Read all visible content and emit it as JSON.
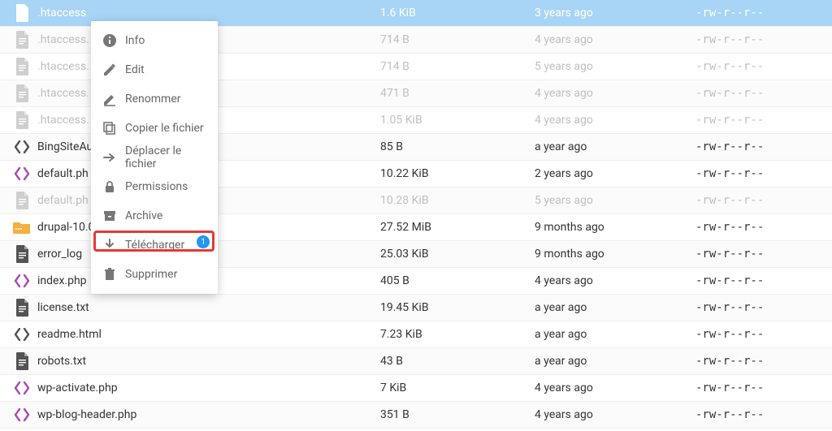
{
  "files": [
    {
      "name": ".htaccess",
      "size": "1.6 KiB",
      "date": "3 years ago",
      "perm": "-rw-r--r--",
      "icon": "doc",
      "selected": true,
      "muted": false
    },
    {
      "name": ".htaccess.",
      "size": "714 B",
      "date": "4 years ago",
      "perm": "-rw-r--r--",
      "icon": "doc",
      "selected": false,
      "muted": true
    },
    {
      "name": ".htaccess.",
      "size": "714 B",
      "date": "5 years ago",
      "perm": "-rw-r--r--",
      "icon": "doc",
      "selected": false,
      "muted": true
    },
    {
      "name": ".htaccess.",
      "size": "471 B",
      "date": "4 years ago",
      "perm": "-rw-r--r--",
      "icon": "doc",
      "selected": false,
      "muted": true
    },
    {
      "name": ".htaccess.",
      "size": "1.05 KiB",
      "date": "4 years ago",
      "perm": "-rw-r--r--",
      "icon": "doc",
      "selected": false,
      "muted": true
    },
    {
      "name": "BingSiteAu",
      "size": "85 B",
      "date": "a year ago",
      "perm": "-rw-r--r--",
      "icon": "code",
      "selected": false,
      "muted": false
    },
    {
      "name": "default.ph",
      "size": "10.22 KiB",
      "date": "2 years ago",
      "perm": "-rw-r--r--",
      "icon": "codep",
      "selected": false,
      "muted": false
    },
    {
      "name": "default.ph",
      "size": "10.28 KiB",
      "date": "5 years ago",
      "perm": "-rw-r--r--",
      "icon": "doc",
      "selected": false,
      "muted": true
    },
    {
      "name": "drupal-10.0",
      "size": "27.52 MiB",
      "date": "9 months ago",
      "perm": "-rw-r--r--",
      "icon": "folder",
      "selected": false,
      "muted": false
    },
    {
      "name": "error_log",
      "size": "25.03 KiB",
      "date": "9 months ago",
      "perm": "-rw-r--r--",
      "icon": "docd",
      "selected": false,
      "muted": false
    },
    {
      "name": "index.php",
      "size": "405 B",
      "date": "4 years ago",
      "perm": "-rw-r--r--",
      "icon": "codep",
      "selected": false,
      "muted": false
    },
    {
      "name": "license.txt",
      "size": "19.45 KiB",
      "date": "a year ago",
      "perm": "-rw-r--r--",
      "icon": "docd",
      "selected": false,
      "muted": false
    },
    {
      "name": "readme.html",
      "size": "7.23 KiB",
      "date": "a year ago",
      "perm": "-rw-r--r--",
      "icon": "code",
      "selected": false,
      "muted": false
    },
    {
      "name": "robots.txt",
      "size": "43 B",
      "date": "a year ago",
      "perm": "-rw-r--r--",
      "icon": "docd",
      "selected": false,
      "muted": false
    },
    {
      "name": "wp-activate.php",
      "size": "7 KiB",
      "date": "4 years ago",
      "perm": "-rw-r--r--",
      "icon": "codep",
      "selected": false,
      "muted": false
    },
    {
      "name": "wp-blog-header.php",
      "size": "351 B",
      "date": "4 years ago",
      "perm": "-rw-r--r--",
      "icon": "codep",
      "selected": false,
      "muted": false
    }
  ],
  "menu": [
    {
      "icon": "info",
      "label": "Info"
    },
    {
      "icon": "edit",
      "label": "Edit"
    },
    {
      "icon": "rename",
      "label": "Renommer"
    },
    {
      "icon": "copy",
      "label": "Copier le fichier"
    },
    {
      "icon": "move",
      "label": "Déplacer le fichier"
    },
    {
      "icon": "lock",
      "label": "Permissions"
    },
    {
      "icon": "archive",
      "label": "Archive"
    },
    {
      "icon": "download",
      "label": "Télécharger",
      "badge": "1"
    },
    {
      "icon": "delete",
      "label": "Supprimer"
    }
  ]
}
